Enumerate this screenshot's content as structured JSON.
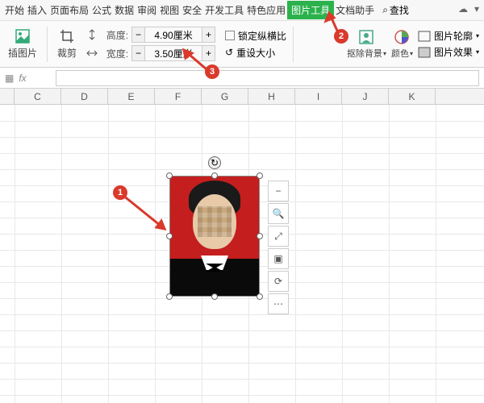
{
  "menu": {
    "items": [
      "开始",
      "插入",
      "页面布局",
      "公式",
      "数据",
      "审阅",
      "视图",
      "安全",
      "开发工具",
      "特色应用",
      "图片工具",
      "文档助手"
    ],
    "active_index": 10,
    "find_label": "查找"
  },
  "ribbon": {
    "insert_pic": "插图片",
    "crop": "裁剪",
    "height_label": "高度:",
    "width_label": "宽度:",
    "height_val": "4.90厘米",
    "width_val": "3.50厘米",
    "lock_ratio": "锁定纵横比",
    "reset_size": "重设大小",
    "remove_bg": "抠除背景",
    "color": "颜色",
    "outline": "图片轮廓",
    "effects": "图片效果"
  },
  "fx": {
    "symbol": "fx"
  },
  "columns": [
    "C",
    "D",
    "E",
    "F",
    "G",
    "H",
    "I",
    "J",
    "K"
  ],
  "annotations": {
    "a1": "1",
    "a2": "2",
    "a3": "3"
  },
  "icons": {
    "minus": "−",
    "plus": "+",
    "search": "⌕",
    "reset": "↺",
    "zoomout": "−",
    "zoomin": "🔍",
    "expand": "⤢",
    "cropf": "▣",
    "rotf": "⟳",
    "more": "⋯",
    "cloud": "☁",
    "chev": "▾",
    "rot": "↻"
  }
}
